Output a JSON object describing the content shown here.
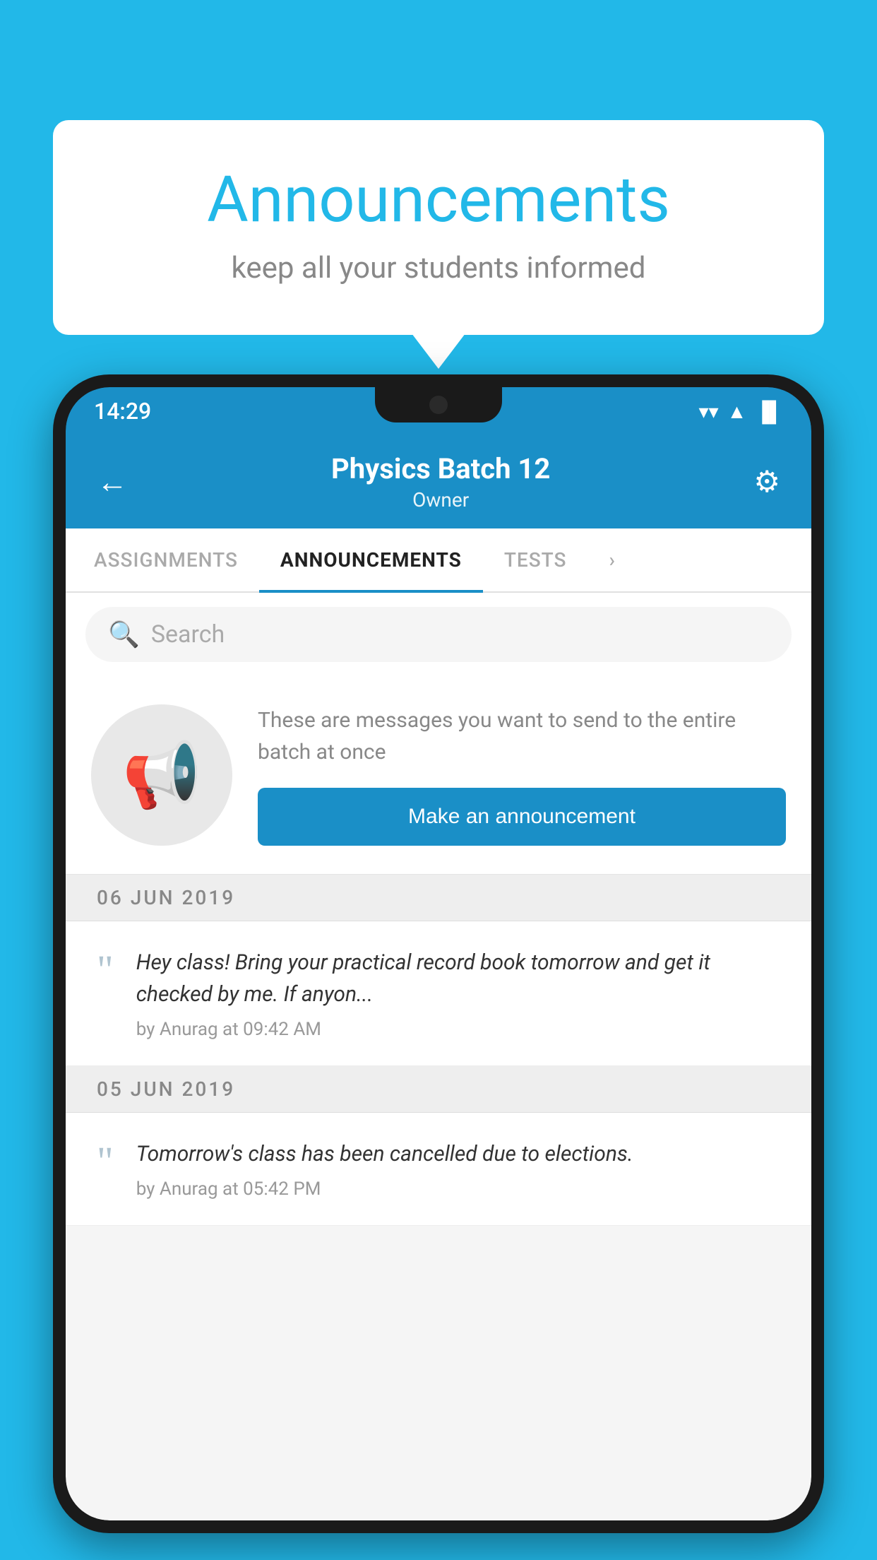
{
  "background_color": "#22b8e8",
  "speech_bubble": {
    "title": "Announcements",
    "subtitle": "keep all your students informed"
  },
  "status_bar": {
    "time": "14:29",
    "wifi": "▾",
    "signal": "▴",
    "battery": "▪"
  },
  "app_header": {
    "back_icon": "←",
    "title": "Physics Batch 12",
    "subtitle": "Owner",
    "settings_icon": "⚙"
  },
  "tabs": [
    {
      "label": "ASSIGNMENTS",
      "active": false
    },
    {
      "label": "ANNOUNCEMENTS",
      "active": true
    },
    {
      "label": "TESTS",
      "active": false
    },
    {
      "label": "",
      "active": false
    }
  ],
  "search": {
    "placeholder": "Search",
    "icon": "🔍"
  },
  "announcement_prompt": {
    "description_text": "These are messages you want to send to the entire batch at once",
    "button_label": "Make an announcement"
  },
  "announcement_list": [
    {
      "date": "06  JUN  2019",
      "text": "Hey class! Bring your practical record book tomorrow and get it checked by me. If anyon...",
      "meta": "by Anurag at 09:42 AM"
    },
    {
      "date": "05  JUN  2019",
      "text": "Tomorrow's class has been cancelled due to elections.",
      "meta": "by Anurag at 05:42 PM"
    }
  ]
}
